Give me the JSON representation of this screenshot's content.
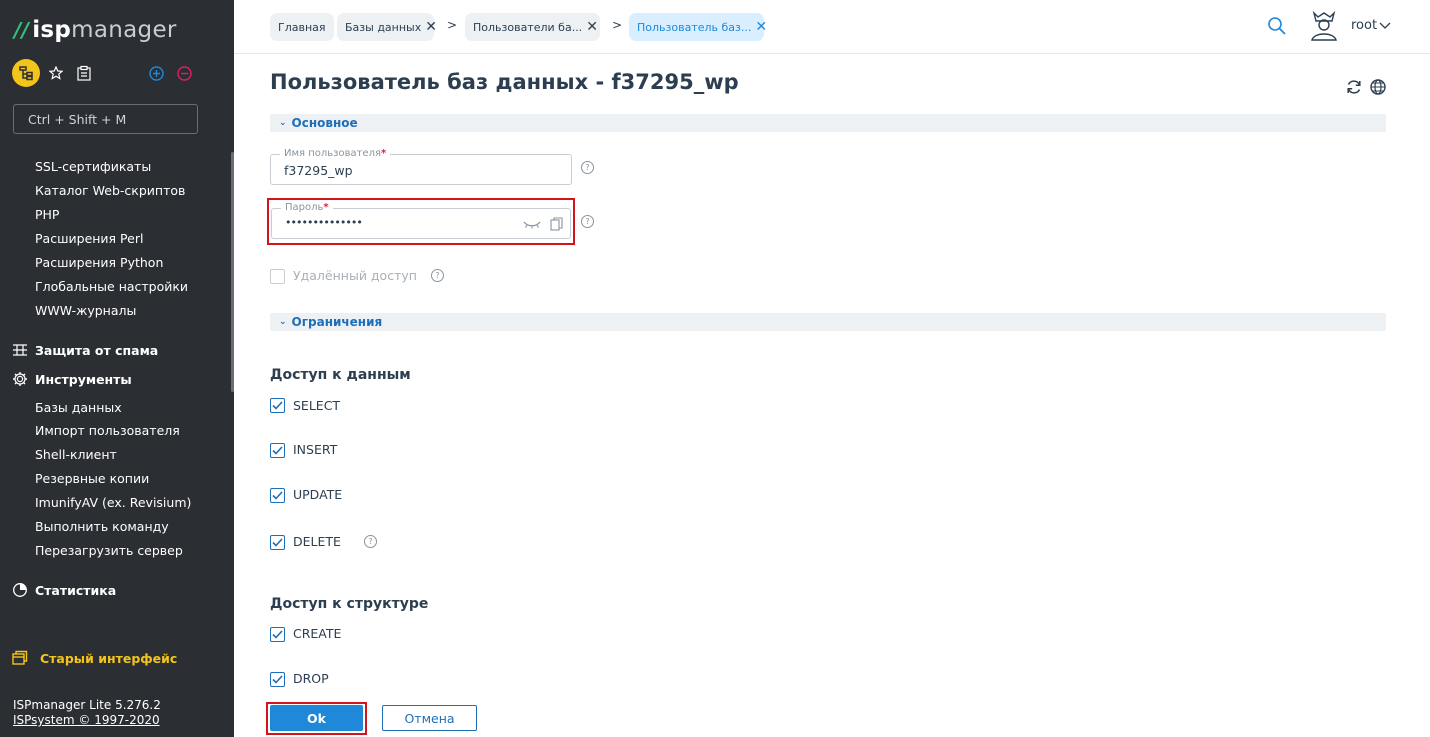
{
  "app": {
    "logo_isp": "isp",
    "logo_manager": "manager"
  },
  "sidebar": {
    "search_placeholder": "Ctrl + Shift + M",
    "items_top": [
      "SSL-сертификаты",
      "Каталог Web-скриптов",
      "PHP",
      "Расширения Perl",
      "Расширения Python",
      "Глобальные настройки",
      "WWW-журналы"
    ],
    "group_spam": "Защита от спама",
    "group_tools": "Инструменты",
    "items_tools": [
      "Базы данных",
      "Импорт пользователя",
      "Shell-клиент",
      "Резервные копии",
      "ImunifyAV (ex. Revisium)",
      "Выполнить команду",
      "Перезагрузить сервер"
    ],
    "group_stats": "Статистика",
    "old_interface": "Старый интерфейс",
    "version": "ISPmanager Lite 5.276.2",
    "copyright": "ISPsystem © 1997-2020"
  },
  "topbar": {
    "tabs": [
      {
        "label": "Главная"
      },
      {
        "label": "Базы данных"
      },
      {
        "label": "Пользователи ба..."
      },
      {
        "label": "Пользователь баз..."
      }
    ],
    "separator": ">",
    "user": "root"
  },
  "content": {
    "title": "Пользователь баз данных - f37295_wp",
    "section_main": "Основное",
    "username_label": "Имя пользователя",
    "username_value": "f37295_wp",
    "password_label": "Пароль",
    "password_value": "••••••••••••••",
    "required_mark": "*",
    "remote_access": "Удалённый доступ",
    "section_limits": "Ограничения",
    "data_access_title": "Доступ к данным",
    "data_access": [
      "SELECT",
      "INSERT",
      "UPDATE",
      "DELETE"
    ],
    "structure_title": "Доступ к структуре",
    "structure_access": [
      "CREATE",
      "DROP"
    ],
    "ok": "Ok",
    "cancel": "Отмена",
    "help_glyph": "?"
  },
  "colors": {
    "sidebar_bg": "#2b2e33",
    "accent": "#1f88d9",
    "highlight": "#f3c51a",
    "logo_green": "#34c27a",
    "annotation_red": "#d4141c"
  }
}
